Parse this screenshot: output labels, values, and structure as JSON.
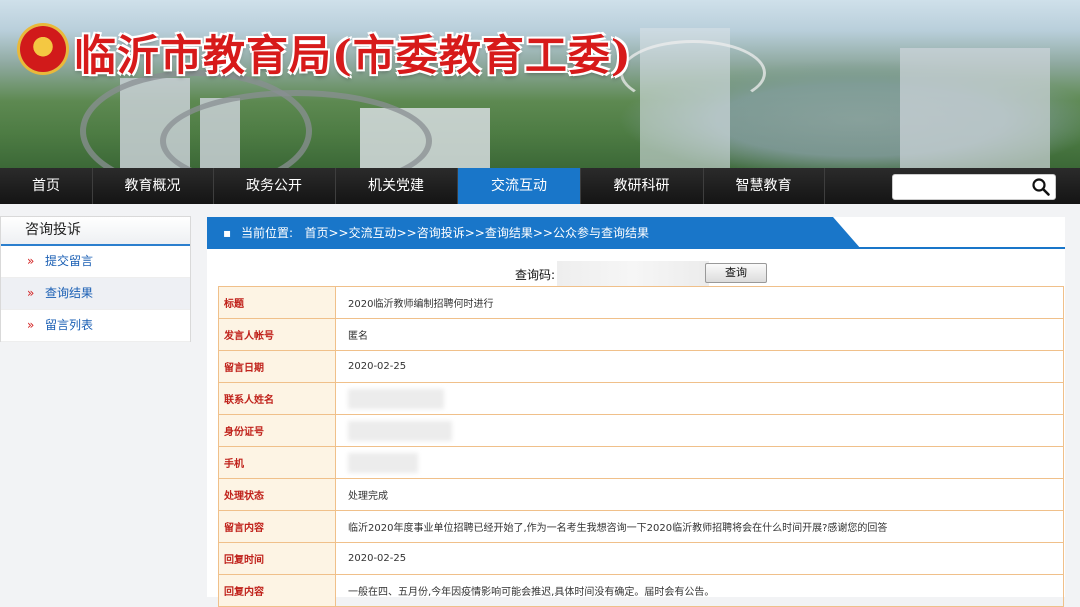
{
  "site": {
    "title": "临沂市教育局(市委教育工委)",
    "seal_icon": "national-emblem-icon",
    "title_color": "#d71a1a"
  },
  "nav": {
    "items": [
      "首页",
      "教育概况",
      "政务公开",
      "机关党建",
      "交流互动",
      "教研科研",
      "智慧教育"
    ],
    "active": "交流互动",
    "accent": "#1976c9",
    "search_placeholder": "",
    "search_icon": "magnifier-icon"
  },
  "sidebar": {
    "title": "咨询投诉",
    "items": [
      "提交留言",
      "查询结果",
      "留言列表"
    ]
  },
  "breadcrumb": {
    "prefix": "当前位置:",
    "parts": [
      "首页",
      ">>",
      "交流互动",
      ">>",
      "咨询投诉",
      ">>",
      "查询结果",
      ">>",
      "公众参与查询结果"
    ]
  },
  "query": {
    "label": "查询码:",
    "value": "",
    "button": "查询"
  },
  "record": {
    "rows": [
      {
        "label": "标题",
        "value": "2020临沂教师编制招聘何时进行"
      },
      {
        "label": "发言人帐号",
        "value": "匿名"
      },
      {
        "label": "留言日期",
        "value": "2020-02-25"
      },
      {
        "label": "联系人姓名",
        "value": ""
      },
      {
        "label": "身份证号",
        "value": ""
      },
      {
        "label": "手机",
        "value": ""
      },
      {
        "label": "处理状态",
        "value": "处理完成"
      },
      {
        "label": "留言内容",
        "value": "临沂2020年度事业单位招聘已经开始了,作为一名考生我想咨询一下2020临沂教师招聘将会在什么时间开展?感谢您的回答"
      },
      {
        "label": "回复时间",
        "value": "2020-02-25"
      },
      {
        "label": "回复内容",
        "value": "一般在四、五月份,今年因疫情影响可能会推迟,具体时间没有确定。届时会有公告。"
      }
    ]
  }
}
